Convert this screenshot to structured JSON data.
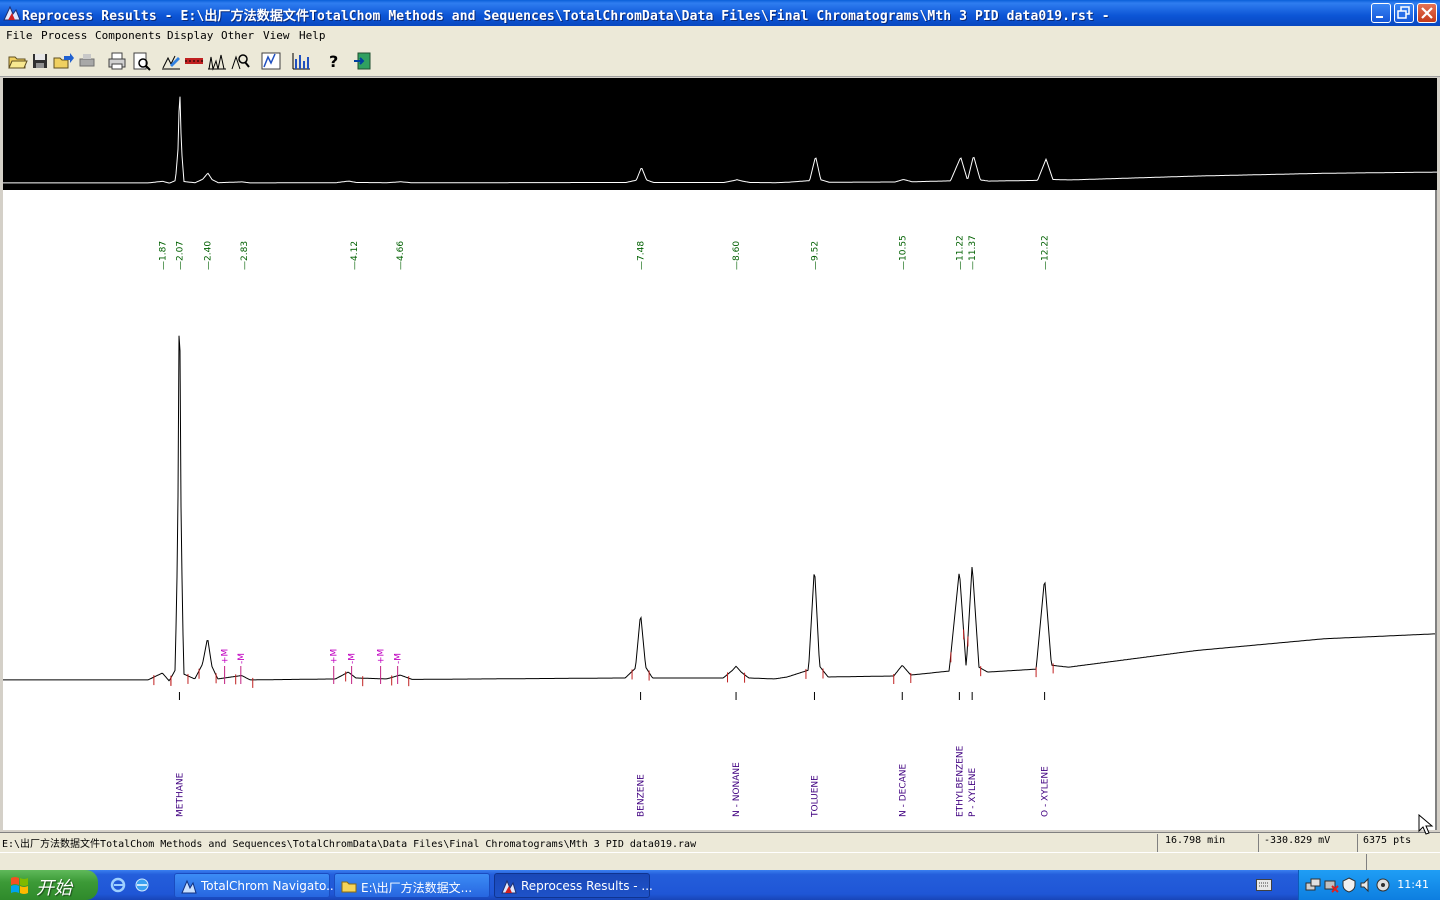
{
  "window": {
    "title": "Reprocess Results  - E:\\出厂方法数据文件TotalChom Methods and Sequences\\TotalChromData\\Data Files\\Final Chromatograms\\Mth 3 PID data019.rst -"
  },
  "menu": [
    "File",
    "Process",
    "Components",
    "Display",
    "Other",
    "View",
    "Help"
  ],
  "toolbar": [
    "open-icon",
    "save-icon",
    "export-icon",
    "print-setup-icon",
    "print-icon",
    "print-preview-icon",
    "graph-edit-icon",
    "baseline-icon",
    "peaks-icon",
    "zoom-icon",
    "overlay-icon",
    "bar-chart-icon",
    "help-icon",
    "exit-icon"
  ],
  "chart_data": {
    "type": "line",
    "x_unit": "min",
    "y_unit": "mV",
    "retention_times": [
      "1.87",
      "2.07",
      "2.40",
      "2.83",
      "4.12",
      "4.66",
      "7.48",
      "8.60",
      "9.52",
      "10.55",
      "11.22",
      "11.37",
      "12.22"
    ],
    "components": [
      {
        "name": "METHANE",
        "rt": 2.07
      },
      {
        "name": "BENZENE",
        "rt": 7.48
      },
      {
        "name": "N - NONANE",
        "rt": 8.6
      },
      {
        "name": "TOLUENE",
        "rt": 9.52
      },
      {
        "name": "N - DECANE",
        "rt": 10.55
      },
      {
        "name": "ETHYLBENZENE",
        "rt": 11.22
      },
      {
        "name": "P - XYLENE",
        "rt": 11.37
      },
      {
        "name": "O - XYLENE",
        "rt": 12.22
      }
    ],
    "markers": [
      {
        "label": "+M",
        "rt": 2.6
      },
      {
        "label": "-M",
        "rt": 2.79
      },
      {
        "label": "+M",
        "rt": 3.88
      },
      {
        "label": "-M",
        "rt": 4.09
      },
      {
        "label": "+M",
        "rt": 4.43
      },
      {
        "label": "-M",
        "rt": 4.63
      }
    ],
    "trace": [
      [
        0,
        -0.4
      ],
      [
        1.7,
        -0.4
      ],
      [
        1.87,
        0.3
      ],
      [
        1.95,
        -0.5
      ],
      [
        2.02,
        0.6
      ],
      [
        2.05,
        14
      ],
      [
        2.07,
        42
      ],
      [
        2.09,
        15
      ],
      [
        2.12,
        0.2
      ],
      [
        2.25,
        -0.3
      ],
      [
        2.34,
        1.2
      ],
      [
        2.4,
        3.9
      ],
      [
        2.45,
        1.0
      ],
      [
        2.52,
        -0.3
      ],
      [
        2.8,
        0.05
      ],
      [
        2.9,
        -0.4
      ],
      [
        3.9,
        -0.3
      ],
      [
        4.05,
        0.4
      ],
      [
        4.14,
        -0.2
      ],
      [
        4.5,
        -0.3
      ],
      [
        4.66,
        0.1
      ],
      [
        4.8,
        -0.35
      ],
      [
        7.3,
        -0.2
      ],
      [
        7.42,
        0.8
      ],
      [
        7.48,
        6.4
      ],
      [
        7.54,
        0.9
      ],
      [
        7.62,
        -0.2
      ],
      [
        8.45,
        -0.2
      ],
      [
        8.56,
        0.6
      ],
      [
        8.6,
        1.0
      ],
      [
        8.66,
        0.4
      ],
      [
        8.75,
        -0.2
      ],
      [
        9.05,
        -0.3
      ],
      [
        9.2,
        -0.1
      ],
      [
        9.45,
        0.6
      ],
      [
        9.52,
        11.2
      ],
      [
        9.58,
        1.0
      ],
      [
        9.68,
        -0.1
      ],
      [
        10.45,
        0.0
      ],
      [
        10.55,
        1.1
      ],
      [
        10.65,
        0.1
      ],
      [
        11.1,
        0.5
      ],
      [
        11.22,
        10.8
      ],
      [
        11.3,
        0.8
      ],
      [
        11.37,
        11.4
      ],
      [
        11.45,
        0.9
      ],
      [
        11.55,
        0.4
      ],
      [
        12.12,
        0.7
      ],
      [
        12.22,
        10.0
      ],
      [
        12.3,
        1.1
      ],
      [
        12.5,
        0.9
      ],
      [
        14.0,
        2.6
      ],
      [
        15.5,
        3.8
      ],
      [
        16.798,
        4.3
      ]
    ],
    "xlim": [
      0,
      16.8
    ]
  },
  "status": {
    "path": "E:\\出厂方法数据文件TotalChom Methods and Sequences\\TotalChromData\\Data Files\\Final Chromatograms\\Mth 3 PID data019.raw",
    "time": "16.798 min",
    "signal": "-330.829 mV",
    "points": "6375 pts"
  },
  "taskbar": {
    "start": "开始",
    "tasks": [
      {
        "label": "TotalChrom Navigato...",
        "active": false
      },
      {
        "label": "E:\\出厂方法数据文...",
        "active": false
      },
      {
        "label": "Reprocess Results - ...",
        "active": true
      }
    ],
    "clock": "11:41"
  }
}
